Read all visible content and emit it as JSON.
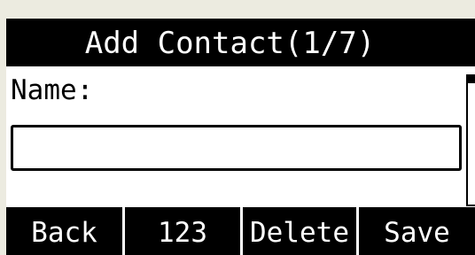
{
  "title": "Add Contact(1/7)",
  "form": {
    "name_label": "Name:",
    "name_value": ""
  },
  "softkeys": {
    "back": "Back",
    "numeric": "123",
    "delete": "Delete",
    "save": "Save"
  },
  "colors": {
    "background": "#ecebe0",
    "screen": "#ffffff",
    "bar": "#000000",
    "bar_text": "#ffffff"
  }
}
